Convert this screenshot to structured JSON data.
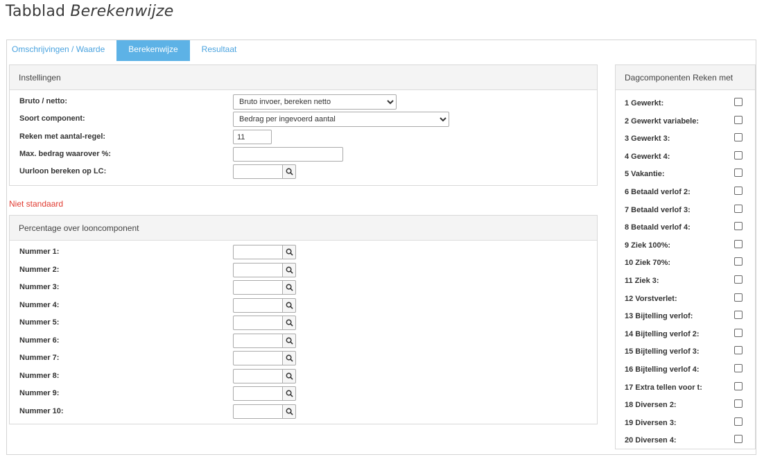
{
  "page_title": {
    "prefix": "Tabblad",
    "emphasis": "Berekenwijze"
  },
  "tabs": [
    {
      "label": "Omschrijvingen / Waarde",
      "active": false
    },
    {
      "label": "Berekenwijze",
      "active": true
    },
    {
      "label": "Resultaat",
      "active": false
    }
  ],
  "instellingen": {
    "title": "Instellingen",
    "bruto_netto": {
      "label": "Bruto / netto:",
      "value": "Bruto invoer, bereken netto"
    },
    "soort_component": {
      "label": "Soort component:",
      "value": "Bedrag per ingevoerd aantal"
    },
    "reken_met": {
      "label": "Reken met aantal-regel:",
      "value": "11"
    },
    "max_bedrag": {
      "label": "Max. bedrag waarover %:",
      "value": ""
    },
    "uurloon": {
      "label": "Uurloon bereken op LC:",
      "value": ""
    }
  },
  "niet_standaard": "Niet standaard",
  "percentage": {
    "title": "Percentage over looncomponent",
    "items": [
      {
        "label": "Nummer 1:",
        "value": ""
      },
      {
        "label": "Nummer 2:",
        "value": ""
      },
      {
        "label": "Nummer 3:",
        "value": ""
      },
      {
        "label": "Nummer 4:",
        "value": ""
      },
      {
        "label": "Nummer 5:",
        "value": ""
      },
      {
        "label": "Nummer 6:",
        "value": ""
      },
      {
        "label": "Nummer 7:",
        "value": ""
      },
      {
        "label": "Nummer 8:",
        "value": ""
      },
      {
        "label": "Nummer 9:",
        "value": ""
      },
      {
        "label": "Nummer 10:",
        "value": ""
      }
    ]
  },
  "dagcomponenten": {
    "title": "Dagcomponenten Reken met",
    "items": [
      {
        "label": "1 Gewerkt:",
        "checked": false
      },
      {
        "label": "2 Gewerkt variabele:",
        "checked": false
      },
      {
        "label": "3 Gewerkt 3:",
        "checked": false
      },
      {
        "label": "4 Gewerkt 4:",
        "checked": false
      },
      {
        "label": "5 Vakantie:",
        "checked": false
      },
      {
        "label": "6 Betaald verlof 2:",
        "checked": false
      },
      {
        "label": "7 Betaald verlof 3:",
        "checked": false
      },
      {
        "label": "8 Betaald verlof 4:",
        "checked": false
      },
      {
        "label": "9 Ziek 100%:",
        "checked": false
      },
      {
        "label": "10 Ziek 70%:",
        "checked": false
      },
      {
        "label": "11 Ziek 3:",
        "checked": false
      },
      {
        "label": "12 Vorstverlet:",
        "checked": false
      },
      {
        "label": "13 Bijtelling verlof:",
        "checked": false
      },
      {
        "label": "14 Bijtelling verlof 2:",
        "checked": false
      },
      {
        "label": "15 Bijtelling verlof 3:",
        "checked": false
      },
      {
        "label": "16 Bijtelling verlof 4:",
        "checked": false
      },
      {
        "label": "17 Extra tellen voor t:",
        "checked": false
      },
      {
        "label": "18 Diversen 2:",
        "checked": false
      },
      {
        "label": "19 Diversen 3:",
        "checked": false
      },
      {
        "label": "20 Diversen 4:",
        "checked": false
      }
    ]
  },
  "icons": {
    "lookup": "search-icon",
    "dropdown": "chevron-down-icon"
  },
  "colors": {
    "tab_active": "#5db2e6",
    "tab_link": "#4aa3df",
    "warning": "#e0392f"
  }
}
